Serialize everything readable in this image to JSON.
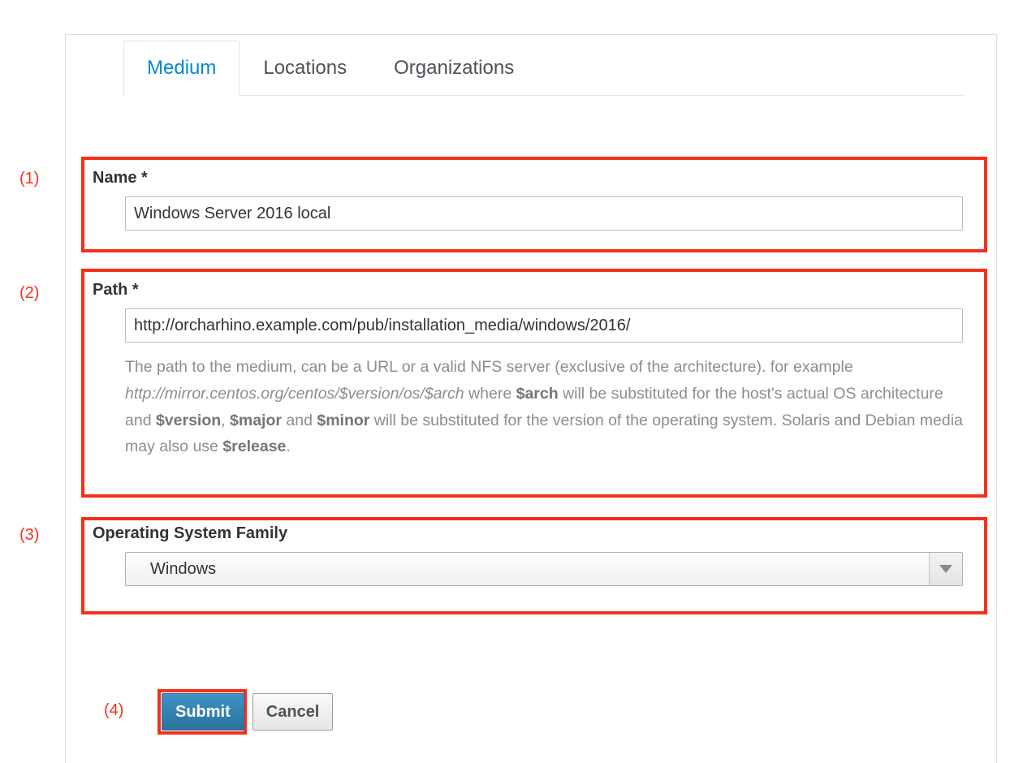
{
  "tabs": [
    {
      "label": "Medium",
      "active": true
    },
    {
      "label": "Locations",
      "active": false
    },
    {
      "label": "Organizations",
      "active": false
    }
  ],
  "form": {
    "name": {
      "label": "Name *",
      "value": "Windows Server 2016 local",
      "placeholder": ""
    },
    "path": {
      "label": "Path *",
      "value": "http://orcharhino.example.com/pub/installation_media/windows/2016/",
      "placeholder": "",
      "help": {
        "part1": "The path to the medium, can be a URL or a valid NFS server (exclusive of the architecture). for example ",
        "example_url": "http://mirror.centos.org/centos/$version/os/$arch",
        "part2": " where ",
        "var_arch": "$arch",
        "part3": " will be substituted for the host's actual OS architecture and ",
        "var_version": "$version",
        "part4": ", ",
        "var_major": "$major",
        "part5": " and ",
        "var_minor": "$minor",
        "part6": " will be substituted for the version of the operating system. Solaris and Debian media may also use ",
        "var_release": "$release",
        "part7": "."
      }
    },
    "os_family": {
      "label": "Operating System Family",
      "value": "Windows"
    }
  },
  "buttons": {
    "submit": "Submit",
    "cancel": "Cancel"
  },
  "annotations": {
    "one": "(1)",
    "two": "(2)",
    "three": "(3)",
    "four": "(4)"
  },
  "colors": {
    "annotation_red": "#f4301d",
    "active_tab_blue": "#0088ce",
    "submit_blue": "#2b719e",
    "help_gray": "#8b8d8f"
  }
}
